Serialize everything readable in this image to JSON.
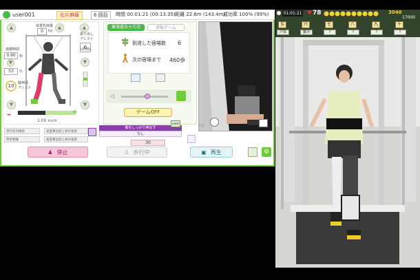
{
  "header": {
    "user": "user001",
    "mode": "右片麻痺",
    "session": "6 回目",
    "time": "時間 00:01:21 (00:13:35)",
    "distance": "距離 22.6m (143.4m)",
    "success_rate": "成功率 100% (99%)"
  },
  "leg": {
    "knee_fix_label": "体重負荷量",
    "knee_unit": "kg",
    "knee_value": "0",
    "assist_label": "振り出し\nアシスト",
    "assist_value": "6",
    "assist_unit": "LEVEL",
    "stride_label": "遊脚時間",
    "stride_value": "0.90",
    "stride_unit": "秒",
    "angle_value": "53",
    "angle_unit": "%",
    "extension_label": "膝伸展\nアシスト",
    "extension_value": "10",
    "speed_value": "1.00",
    "speed_unit": "km/h",
    "bottom_buttons": [
      "歩行前の練習",
      "速度算出前と後の速度",
      "単歩距離",
      "速度算出前と後の速度"
    ]
  },
  "game": {
    "tab_active": "東海道五十三次",
    "tab_inactive": "逆転ゲーム",
    "arrived_label": "到達した宿場数",
    "arrived_value": "6",
    "next_label": "次の宿場まで",
    "next_value": "460歩",
    "toggle_label": "ゲームOFF",
    "game_badge": "GAME"
  },
  "misc": {
    "purple_label": "膝をしっかり伸ばす",
    "purple_value": "なし",
    "value_30": "30",
    "f8": "F8"
  },
  "footer": {
    "stop": "停止",
    "walking": "歩行中",
    "replay": "再生"
  },
  "overlay": {
    "time": "01:01:21",
    "bpm": "78",
    "score_top": "3040",
    "score_bottom": "17000",
    "stations": [
      "五",
      "六",
      "七",
      "八",
      "九",
      "十"
    ],
    "station_names": [
      "戸塚",
      "藤沢",
      "?",
      "?",
      "?",
      "?"
    ]
  },
  "colors": {
    "accent": "#6ccc3a",
    "pink": "#f7b6d2",
    "purple": "#8b3fa8"
  }
}
